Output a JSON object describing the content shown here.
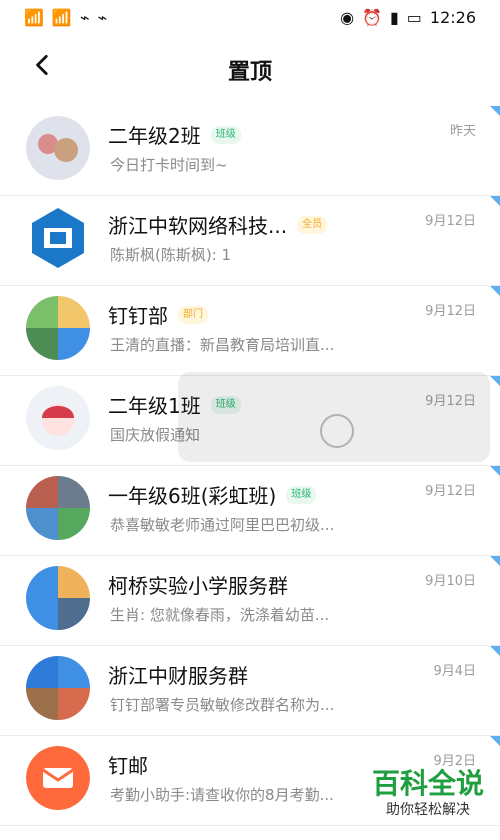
{
  "statusbar": {
    "time": "12:26",
    "battery": "100",
    "left_text": "\"\"\"\"",
    "right_icons": [
      "eye-icon",
      "alarm-icon",
      "vibrate-icon",
      "battery-icon"
    ]
  },
  "header": {
    "title": "置顶"
  },
  "chats": [
    {
      "name": "二年级2班",
      "badge": "班级",
      "preview": "今日打卡时间到~",
      "time": "昨天"
    },
    {
      "name": "浙江中软网络科技...",
      "badge": "全员",
      "preview": "陈斯枫(陈斯枫): 1",
      "time": "9月12日"
    },
    {
      "name": "钉钉部",
      "badge": "部门",
      "preview": "王清的直播：新昌教育局培训直...",
      "time": "9月12日"
    },
    {
      "name": "二年级1班",
      "badge": "班级",
      "preview": "国庆放假通知",
      "time": "9月12日"
    },
    {
      "name": "一年级6班(彩虹班)",
      "badge": "班级",
      "preview": "恭喜敏敏老师通过阿里巴巴初级...",
      "time": "9月12日"
    },
    {
      "name": "柯桥实验小学服务群",
      "badge": "",
      "preview": "生肖: 您就像春雨，洗涤着幼苗...",
      "time": "9月10日"
    },
    {
      "name": "浙江中财服务群",
      "badge": "",
      "preview": "钉钉部署专员敏敏修改群名称为...",
      "time": "9月4日"
    },
    {
      "name": "钉邮",
      "badge": "",
      "preview": "考勤小助手:请查收你的8月考勤...",
      "time": "9月2日"
    }
  ],
  "watermark": {
    "title": "百科全说",
    "subtitle": "助你轻松解决"
  },
  "colors": {
    "pin": "#5bb0f2",
    "green": "#2bb673",
    "orange": "#ff6a3d"
  }
}
